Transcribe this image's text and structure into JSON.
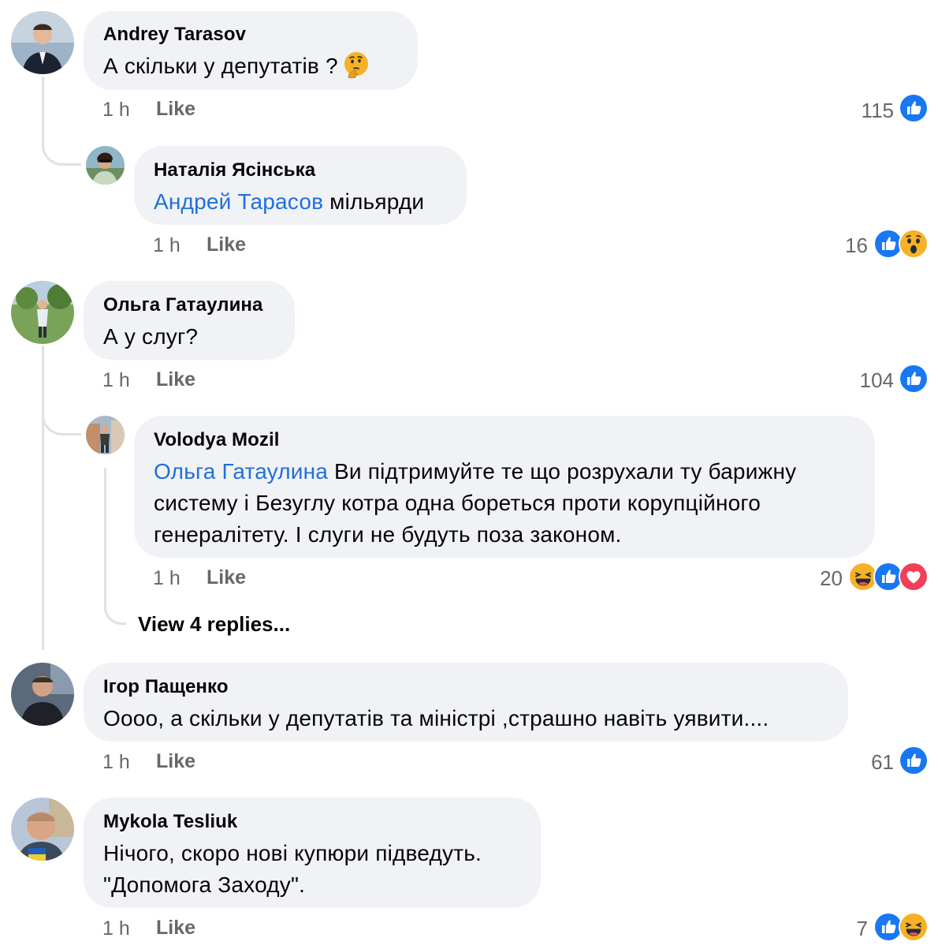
{
  "colors": {
    "bubble": "#f0f2f5",
    "mention": "#216fdb",
    "meta": "#65676b",
    "like_blue": "#1877f2",
    "love_red": "#f33e58",
    "emoji_yellow": "#f7b125"
  },
  "comments": [
    {
      "author": "Andrey Tarasov",
      "text": "А скільки у депутатів ?",
      "inline_emoji": "thinking-face-emoji",
      "time": "1 h",
      "like_label": "Like",
      "count": "115",
      "reactions": [
        "like"
      ]
    },
    {
      "author": "Наталія Ясінська",
      "mention": "Андрей Тарасов",
      "text": " мільярди",
      "time": "1 h",
      "like_label": "Like",
      "count": "16",
      "reactions": [
        "like",
        "wow"
      ]
    },
    {
      "author": "Ольга Гатаулина",
      "text": "А у слуг?",
      "time": "1 h",
      "like_label": "Like",
      "count": "104",
      "reactions": [
        "like"
      ]
    },
    {
      "author": "Volodya Mozil",
      "mention": "Ольга Гатаулина",
      "text_line1": " Ви підтримуйте те що розрухали ту барижну",
      "text_line2": "систему  і Безуглу котра одна бореться проти корупційного",
      "text_line3": "генералітету. І слуги не будуть поза законом.",
      "time": "1 h",
      "like_label": "Like",
      "count": "20",
      "reactions": [
        "haha",
        "like",
        "love"
      ]
    },
    {
      "author": "Ігор Пащенко",
      "text": "Оооо, а скільки у депутатів та міністрі ,страшно навіть уявити....",
      "time": "1 h",
      "like_label": "Like",
      "count": "61",
      "reactions": [
        "like"
      ]
    },
    {
      "author": "Mykola Tesliuk",
      "text_line1": "Нічого, скоро нові купюри підведуть.",
      "text_line2": "\"Допомога Заходу\".",
      "time": "1 h",
      "like_label": "Like",
      "count": "7",
      "reactions": [
        "like",
        "haha"
      ]
    }
  ],
  "view_replies_label": "View 4 replies..."
}
